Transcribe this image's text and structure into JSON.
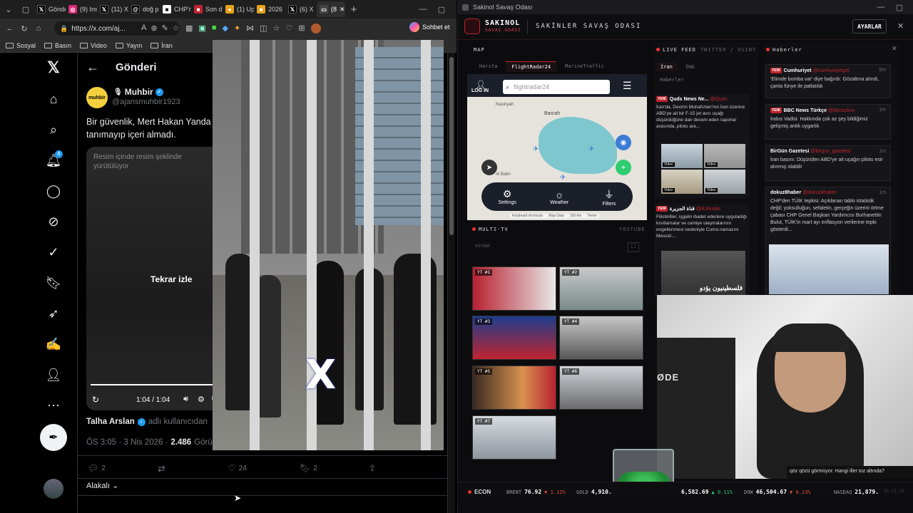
{
  "browser": {
    "tabs": [
      {
        "label": "Gönde",
        "icon": "x-icon",
        "color": "#000000"
      },
      {
        "label": "(9) Ins",
        "icon": "instagram-icon",
        "color": "#d62976"
      },
      {
        "label": "(11) X",
        "icon": "x-icon",
        "color": "#000000"
      },
      {
        "label": "doğ p",
        "icon": "threads-icon",
        "color": "#000000"
      },
      {
        "label": "CHP'n",
        "icon": "news-icon",
        "color": "#ffffff"
      },
      {
        "label": "Son d",
        "icon": "news-icon",
        "color": "#c0242f"
      },
      {
        "label": "(1) Up",
        "icon": "bell-icon",
        "color": "#e6a21a"
      },
      {
        "label": "2026",
        "icon": "news-icon",
        "color": "#e6a21a"
      },
      {
        "label": "(6) X",
        "icon": "x-icon",
        "color": "#000000"
      },
      {
        "label": "(8",
        "icon": "tab-icon",
        "color": "#444444"
      }
    ],
    "url": "https://x.com/aj...",
    "copilot_label": "Sohbet et",
    "bookmarks": [
      "Sosyal",
      "Basın",
      "Video",
      "Yayın",
      "İran"
    ]
  },
  "x": {
    "header_title": "Gönderi",
    "author_name": "Muhbir",
    "author_handle": "@ajansmuhbir1923",
    "avatar_text": "muhbir",
    "notification_count": "8",
    "post_text": "Bir güvenlik, Mert Hakan Yanda tanımayıp içeri almadı.",
    "pip_notice": "Resim içinde resim şeklinde yürütülüyor",
    "replay_label": "Tekrar izle",
    "video_time": "1:04 / 1:04",
    "from_user": "Talha Arslan",
    "from_suffix": "adlı kullanıcıdan",
    "post_time": "ÖS 3:05 · 3 Nis 2026 ·",
    "views": "2.486",
    "views_label": "Görünt",
    "reply_count": "2",
    "like_count": "24",
    "bookmark_count": "2",
    "sort_label": "Alakalı"
  },
  "pip": {
    "watermark": "X"
  },
  "app": {
    "window_title": "Sakinol Savaş Odası",
    "brand": "SAKINOL",
    "brand_sub": "SAVAŞ ODASI",
    "header_title": "SAKİNLER SAVAŞ ODASI",
    "settings_label": "AYARLAR",
    "map": {
      "title": "MAP",
      "tabs": [
        "Harita",
        "FlightRadar24",
        "MarineTraffic"
      ],
      "login_label": "LOG IN",
      "search_placeholder": "flightradar24",
      "city_label": "Basrah",
      "city2": "Nasiriyah",
      "city3": "Al Batin",
      "controls": [
        "Settings",
        "Weather",
        "Filters"
      ],
      "footer": [
        "Keyboard shortcuts",
        "Map Data",
        "100 km",
        "Terms"
      ]
    },
    "live_feed": {
      "title": "LIVE FEED",
      "subtitle": "TWITTER / OSINT",
      "tabs": [
        "İran",
        "İHA"
      ],
      "section": "Haberler",
      "items": [
        {
          "badge": "YENİ",
          "source": "Quds News Ne...",
          "handle": "@Quds",
          "time": "1m",
          "text": "İran'da, Devrim Muhafızları'nın İran üzerine ABD'ye ait bir F-15 jet avcı uçağı düşürdüğüne dair devam eden raporlar arasında, pilotu ara..."
        },
        {
          "badge": "YENİ",
          "source": "قناة الجزيرة",
          "handle": "@AJArabic",
          "time": "1m",
          "text": "Filistinliler, işgalin ibadet ederlere uyguladığı kısıtlamalar ve camiye ulaşmalarının engellenmesi nedeniyle Cuma namazını Mescid-..."
        }
      ],
      "video_label": "Video",
      "arabic_caption": "فلسطينيون يؤدو"
    },
    "news": {
      "title": "Haberler",
      "items": [
        {
          "badge": "YENİ",
          "source": "Cumhuriyet",
          "handle": "@cumhuriyetgzt",
          "time": "5m",
          "text": "'Elimde bomba var' diye bağırdı: Gözaltına alındı, çanta fünye ile patlatıldı"
        },
        {
          "badge": "YENİ",
          "source": "BBC News Türkçe",
          "handle": "@bbcturkce",
          "time": "1m",
          "text": "İndus Vadisi: Hakkında çok az şey bildiğimiz gelişmiş antik uygarlık"
        },
        {
          "badge": "",
          "source": "BirGün Gazetesi",
          "handle": "@birgun_gazetesi",
          "time": "1m",
          "text": "İran basını: Düşürülen ABD'ye ait uçağın pilotu esir alınmış olabilir"
        },
        {
          "badge": "",
          "source": "dokuz8haber",
          "handle": "@dokuz8haber",
          "time": "1m",
          "text": "CHP'den TÜİK tepkisi: Açıklanan tablo istatistik değil; yoksulluğun, sefaletin, gerçeğin üzerini örtme çabası CHP Genel Başkan Yardımcısı Burhanettin Bulut, TÜİK'in mart ayı enflasyon verilerine tepki gösterdi..."
        }
      ]
    },
    "multitv": {
      "title": "MULTI-TV",
      "subtitle": "YOUTUBE",
      "kaynak": "KAYNAK",
      "tiles": [
        "YT #1",
        "YT #2",
        "YT #3",
        "YT #4",
        "YT #5",
        "YT #6",
        "YT #7"
      ]
    },
    "ticker": [
      {
        "name": "ECON",
        "value": "",
        "change": ""
      },
      {
        "name": "BRENT",
        "value": "76.92",
        "change": "▼ 1.12%"
      },
      {
        "name": "GOLD",
        "value": "4,910.",
        "change": ""
      },
      {
        "name": "",
        "value": "6,582.69",
        "change": "▲ 0.11%"
      },
      {
        "name": "DOW",
        "value": "46,504.67",
        "change": "▼ 0.13%"
      },
      {
        "name": "NASDAQ",
        "value": "21,879.",
        "change": ""
      }
    ],
    "clock": "15:11:15",
    "webcam_caption": "qöz qözü görmüyor: Hangi iller toz altında?",
    "webcam_text": "ØDE"
  }
}
